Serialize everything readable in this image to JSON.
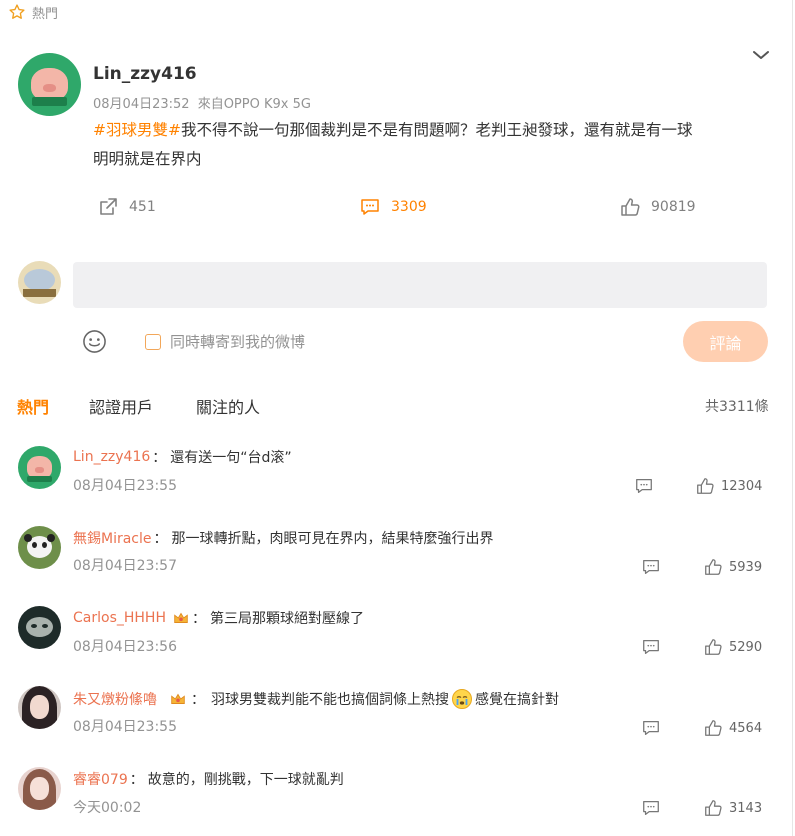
{
  "colors": {
    "accent": "#ff8200",
    "commenter_name": "#eb7350",
    "muted": "#939393",
    "submit_bg": "#ffcfb1"
  },
  "top_tag": {
    "icon": "star-outline-icon",
    "label": "熱門"
  },
  "post": {
    "author": "Lin_zzy416",
    "time": "08月04日23:52",
    "source": "來自OPPO K9x 5G",
    "hashtag": "#羽球男雙#",
    "text_line1": "我不得不說一句那個裁判是不是有問題啊？老判王昶發球，還有就是有一球",
    "text_line2": "明明就是在界内",
    "reposts": "451",
    "comments": "3309",
    "likes": "90819"
  },
  "composer": {
    "placeholder": "",
    "sync_label": "同時轉寄到我的微博",
    "submit_label": "評論"
  },
  "tabs": {
    "hot": "熱門",
    "verified": "認證用戶",
    "following": "關注的人",
    "total": "共3311條"
  },
  "comments": [
    {
      "user": "Lin_zzy416",
      "sep": "：",
      "text": "還有送一句“台d滚”",
      "time": "08月04日23:55",
      "likes": "12304"
    },
    {
      "user": "無錫Miracle",
      "sep": "：",
      "text": "那一球轉折點，肉眼可見在界内，結果特麼強行出界",
      "time": "08月04日23:57",
      "likes": "5939"
    },
    {
      "user": "Carlos_HHHH",
      "sep": "：",
      "text": "第三局那顆球絕對壓線了",
      "time": "08月04日23:56",
      "likes": "5290"
    },
    {
      "user": "朱又燉粉絛嚕",
      "sep": "：",
      "text": "羽球男雙裁判能不能也搞個詞條上熱搜",
      "text2": "感覺在搞針對",
      "time": "08月04日23:55",
      "likes": "4564"
    },
    {
      "user": "睿睿079",
      "sep": "：",
      "text": "故意的，剛挑戰，下一球就亂判",
      "time": "今天00:02",
      "likes": "3143"
    }
  ]
}
